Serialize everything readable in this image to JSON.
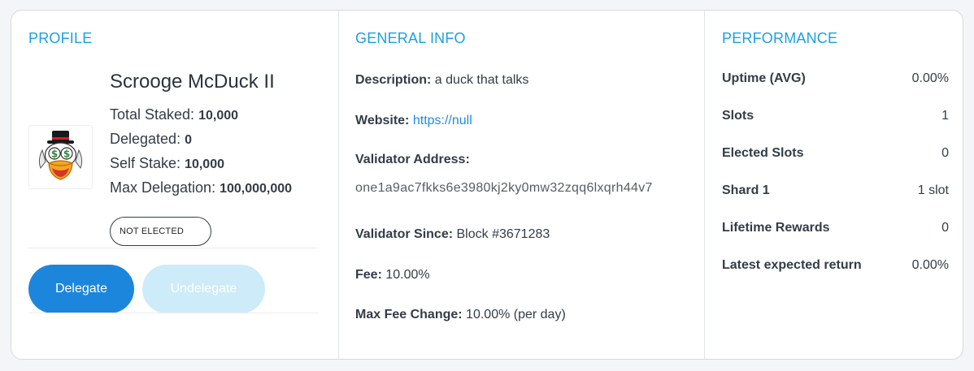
{
  "profile": {
    "title": "PROFILE",
    "name": "Scrooge McDuck II",
    "stats": [
      {
        "label": "Total Staked:",
        "value": "10,000"
      },
      {
        "label": "Delegated:",
        "value": "0"
      },
      {
        "label": "Self Stake:",
        "value": "10,000"
      },
      {
        "label": "Max Delegation:",
        "value": "100,000,000"
      }
    ],
    "status": "NOT ELECTED",
    "delegate_label": "Delegate",
    "undelegate_label": "Undelegate",
    "avatar_icon": "scrooge-mcduck-avatar"
  },
  "general": {
    "title": "GENERAL INFO",
    "description_label": "Description:",
    "description": "a duck that talks",
    "website_label": "Website:",
    "website": "https://null",
    "address_label": "Validator Address:",
    "address": "one1a9ac7fkks6e3980kj2ky0mw32zqq6lxqrh44v7",
    "since_label": "Validator Since:",
    "since": "Block #3671283",
    "fee_label": "Fee:",
    "fee": "10.00%",
    "max_fee_label": "Max Fee Change:",
    "max_fee": "10.00% (per day)"
  },
  "performance": {
    "title": "PERFORMANCE",
    "rows": [
      {
        "label": "Uptime (AVG)",
        "value": "0.00%"
      },
      {
        "label": "Slots",
        "value": "1"
      },
      {
        "label": "Elected Slots",
        "value": "0"
      },
      {
        "label": "Shard 1",
        "value": "1 slot"
      },
      {
        "label": "Lifetime Rewards",
        "value": "0"
      },
      {
        "label": "Latest expected return",
        "value": "0.00%"
      }
    ]
  },
  "colors": {
    "accent": "#1ba1e2",
    "button_primary": "#1c86dd",
    "button_disabled": "#cdebf8",
    "link": "#1f8ce0"
  }
}
